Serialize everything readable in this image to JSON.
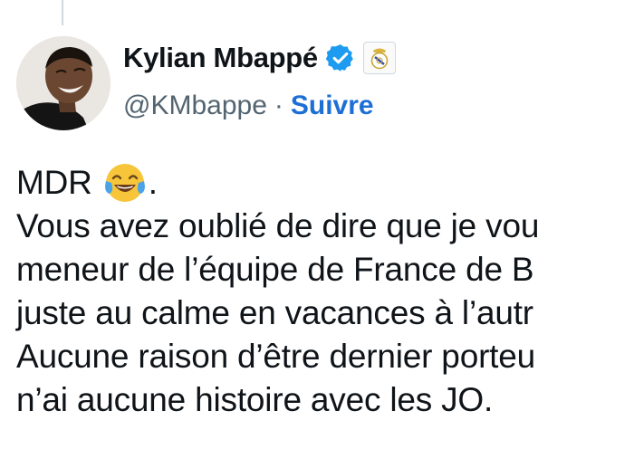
{
  "author": {
    "display_name": "Kylian Mbappé",
    "handle": "@KMbappe",
    "separator": "·",
    "follow_label": "Suivre",
    "verified": true,
    "accent_color": "#1d6fd6"
  },
  "tweet": {
    "first_line_text": "MDR",
    "first_line_emoji": "face-with-tears-of-joy-icon",
    "first_line_suffix": ".",
    "lines": [
      "Vous avez oublié de dire que je vou",
      "meneur de l’équipe de France de B",
      "juste au calme en vacances à l’autr",
      "Aucune raison d’être dernier porteu",
      "n’ai aucune histoire avec les JO."
    ]
  }
}
